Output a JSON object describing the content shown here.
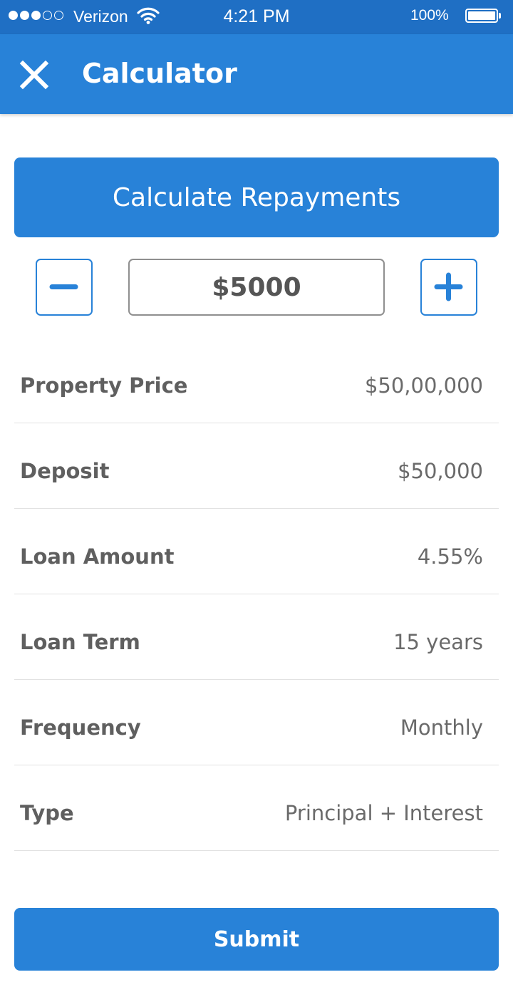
{
  "status_bar": {
    "carrier": "Verizon",
    "time": "4:21 PM",
    "battery": "100%",
    "signal_bars_filled": 3,
    "signal_bars_total": 5
  },
  "app_bar": {
    "title": "Calculator",
    "close_icon": "close-icon"
  },
  "calculate_button": {
    "label": "Calculate Repayments"
  },
  "stepper": {
    "value": "$5000",
    "decrement_icon": "minus-icon",
    "increment_icon": "plus-icon"
  },
  "details": [
    {
      "label": "Property Price",
      "value": "$50,00,000"
    },
    {
      "label": "Deposit",
      "value": "$50,000"
    },
    {
      "label": "Loan Amount",
      "value": "4.55%"
    },
    {
      "label": "Loan Term",
      "value": "15 years"
    },
    {
      "label": "Frequency",
      "value": "Monthly"
    },
    {
      "label": "Type",
      "value": "Principal + Interest"
    }
  ],
  "submit": {
    "label": "Submit"
  },
  "colors": {
    "status_bar": "#1f6fc4",
    "primary": "#2882d8",
    "text": "#5f5f5f",
    "divider": "#e2e2e2"
  }
}
